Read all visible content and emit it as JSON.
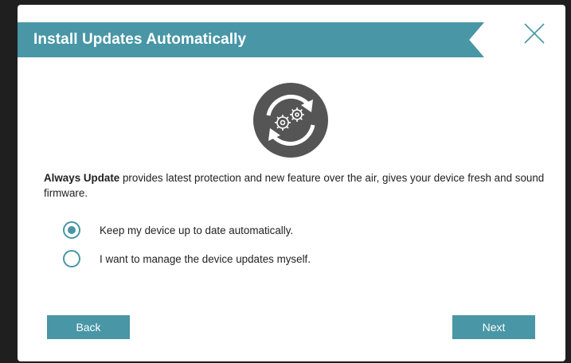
{
  "dialog": {
    "title": "Install Updates Automatically",
    "close_icon": "close-icon",
    "hero_icon": "auto-update-gears-icon",
    "description_bold": "Always Update",
    "description_rest": " provides latest protection and new feature over the air, gives your device fresh and sound firmware.",
    "options": [
      {
        "label": "Keep my device up to date automatically.",
        "selected": true
      },
      {
        "label": "I want to manage the device updates myself.",
        "selected": false
      }
    ],
    "back_label": "Back",
    "next_label": "Next"
  },
  "colors": {
    "accent": "#4896a6",
    "backdrop": "#1f1f1f",
    "icon_dark": "#555555"
  }
}
